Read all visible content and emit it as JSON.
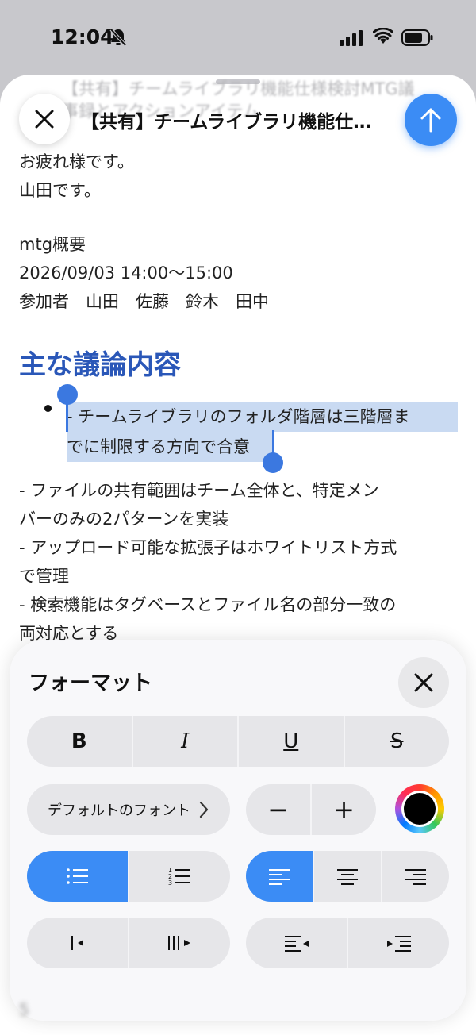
{
  "status": {
    "time": "12:04"
  },
  "header": {
    "subject": "【共有】チームライブラリ機能仕…",
    "ghost_subject": "【共有】チームライブラリ機能仕様検討MTG議事録とアクションアイテム"
  },
  "body": {
    "greeting": "お疲れ様です。",
    "sender": "山田です。",
    "overview_label": "mtg概要",
    "datetime": "2026/09/03 14:00〜15:00",
    "participants": "参加者　山田　佐藤　鈴木　田中",
    "section_heading": "主な議論内容",
    "selected_bullet_line1": "- チームライブラリのフォルダ階層は三階層ま",
    "selected_bullet_line2": "でに制限する方向で合意",
    "paragraph_lines": [
      "- ファイルの共有範囲はチーム全体と、特定メン",
      "バーのみの2パターンを実装",
      "- アップロード可能な拡張子はホワイトリスト方式",
      "で管理",
      "- 検索機能はタグベースとファイル名の部分一致の",
      "両対応とする"
    ],
    "bottom_fragment": "5"
  },
  "format_panel": {
    "title": "フォーマット",
    "bold": "B",
    "italic": "I",
    "underline": "U",
    "strike": "S",
    "font_name": "デフォルトのフォント",
    "minus": "−",
    "plus": "+",
    "selected_color": "#000000",
    "accent": "#3b8cf5",
    "active_list": "bulleted",
    "active_alignment": "left"
  }
}
